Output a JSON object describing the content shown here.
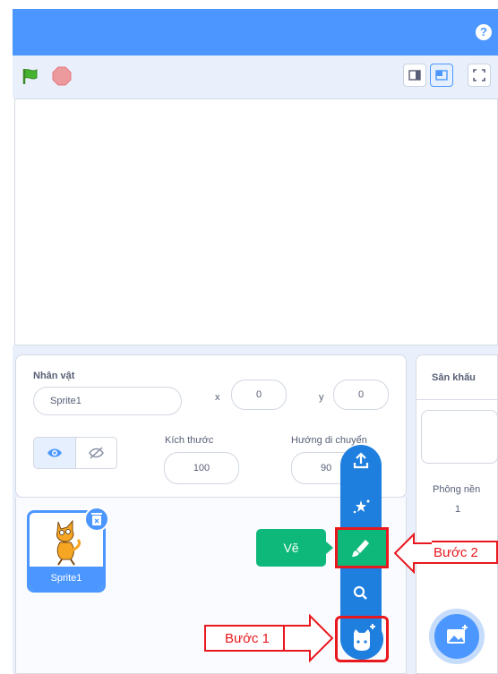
{
  "header": {
    "help_icon": "?"
  },
  "stage_controls": {
    "green_flag": "green-flag-icon",
    "stop": "stop-icon"
  },
  "sprite_info": {
    "title": "Nhân vật",
    "name_value": "Sprite1",
    "x_label": "x",
    "x_value": "0",
    "y_label": "y",
    "y_value": "0",
    "size_label": "Kích thước",
    "size_value": "100",
    "direction_label": "Hướng di chuyển",
    "direction_value": "90"
  },
  "sprite_list": [
    {
      "name": "Sprite1"
    }
  ],
  "stage_panel": {
    "title": "Sân khấu",
    "backdrops_label": "Phông nền",
    "backdrops_count": "1"
  },
  "paint_tooltip": "Vẽ",
  "annotations": {
    "step1": "Bước 1",
    "step2": "Bước 2"
  },
  "colors": {
    "accent": "#4c97ff",
    "menu_blue": "#1e7fdf",
    "tooltip_green": "#0eb87a",
    "annotation_red": "#e8181f"
  }
}
